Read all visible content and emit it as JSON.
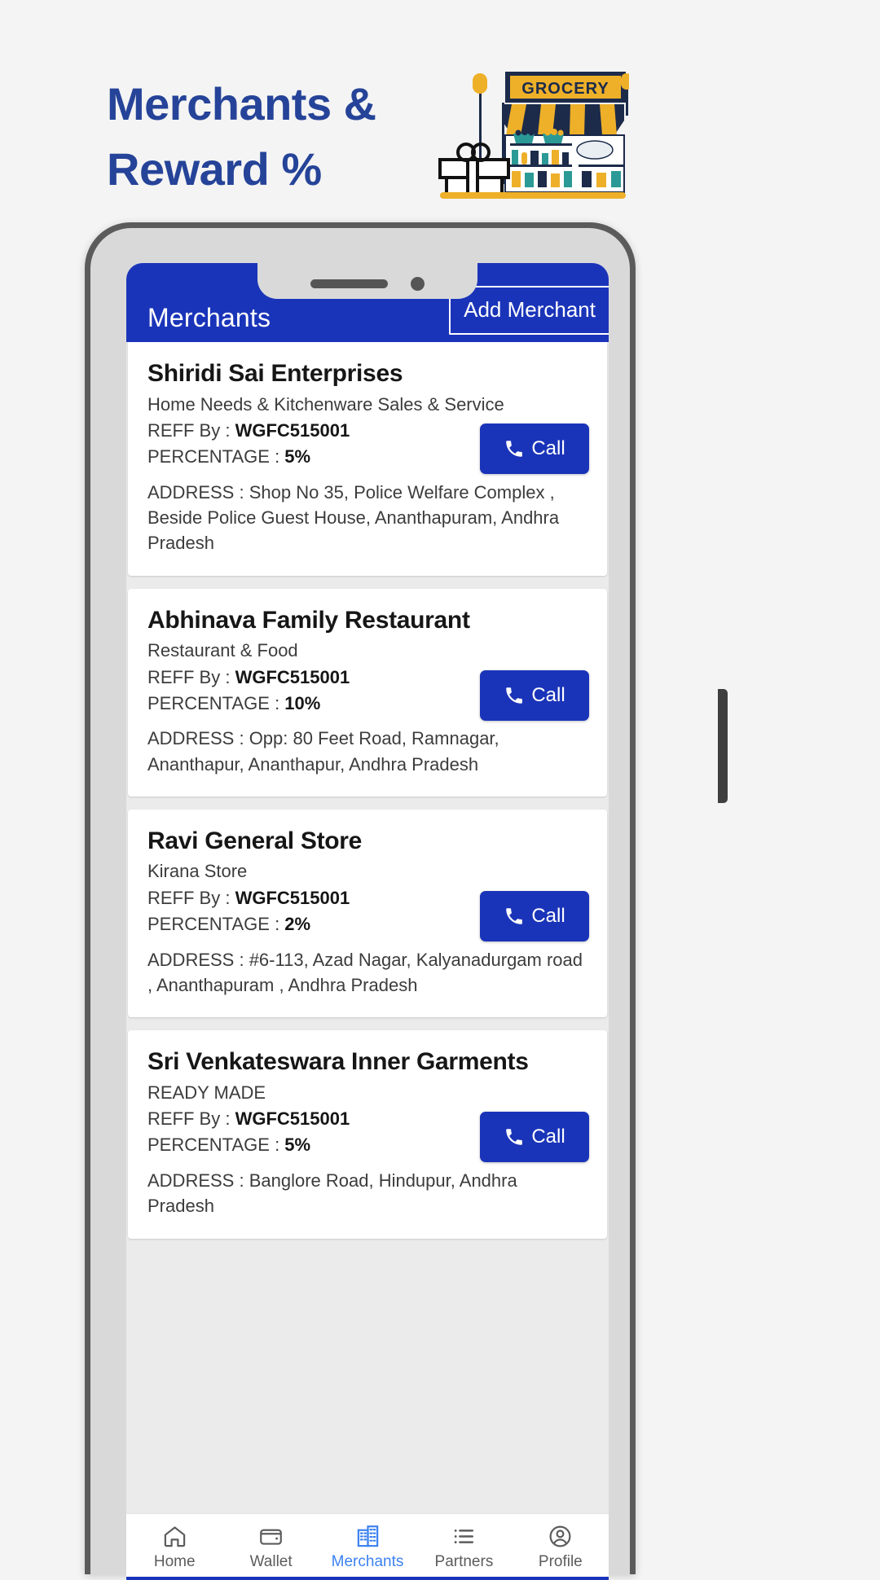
{
  "promo": {
    "title_line1": "Merchants &",
    "title_line2": "Reward %",
    "title_color": "#254398",
    "illustration_name": "grocery-store-gift-illustration",
    "shop_sign_text": "GROCERY"
  },
  "phone": {
    "notch": {
      "speaker": "speaker-grill",
      "camera": "front-camera"
    }
  },
  "appbar": {
    "title": "Merchants",
    "add_button_label": "Add Merchant",
    "background": "#1a34b9"
  },
  "merchants": [
    {
      "name": "Shiridi Sai Enterprises",
      "category": "Home Needs & Kitchenware Sales & Service",
      "reff_label": "REFF By : ",
      "reff_value": "WGFC515001",
      "percentage_label": "PERCENTAGE : ",
      "percentage_value": "5%",
      "address": "ADDRESS : Shop No 35, Police Welfare Complex , Beside Police Guest House, Ananthapuram, Andhra Pradesh",
      "call_label": "Call"
    },
    {
      "name": "Abhinava Family Restaurant",
      "category": "Restaurant & Food",
      "reff_label": "REFF By : ",
      "reff_value": "WGFC515001",
      "percentage_label": "PERCENTAGE : ",
      "percentage_value": "10%",
      "address": "ADDRESS : Opp: 80 Feet Road, Ramnagar, Ananthapur, Ananthapur, Andhra Pradesh",
      "call_label": "Call"
    },
    {
      "name": "Ravi General Store",
      "category": "Kirana Store",
      "reff_label": "REFF By : ",
      "reff_value": "WGFC515001",
      "percentage_label": "PERCENTAGE : ",
      "percentage_value": "2%",
      "address": "ADDRESS : #6-113, Azad Nagar, Kalyanadurgam road , Ananthapuram , Andhra Pradesh",
      "call_label": "Call"
    },
    {
      "name": "Sri Venkateswara Inner Garments",
      "category": "READY MADE",
      "reff_label": "REFF By : ",
      "reff_value": "WGFC515001",
      "percentage_label": "PERCENTAGE : ",
      "percentage_value": "5%",
      "address": "ADDRESS : Banglore Road, Hindupur, Andhra Pradesh",
      "call_label": "Call"
    }
  ],
  "bottom_nav": {
    "active_color": "#3c82f0",
    "items": [
      {
        "label": "Home",
        "icon": "home-icon",
        "active": false
      },
      {
        "label": "Wallet",
        "icon": "wallet-icon",
        "active": false
      },
      {
        "label": "Merchants",
        "icon": "building-icon",
        "active": true
      },
      {
        "label": "Partners",
        "icon": "list-icon",
        "active": false
      },
      {
        "label": "Profile",
        "icon": "account-icon",
        "active": false
      }
    ]
  }
}
